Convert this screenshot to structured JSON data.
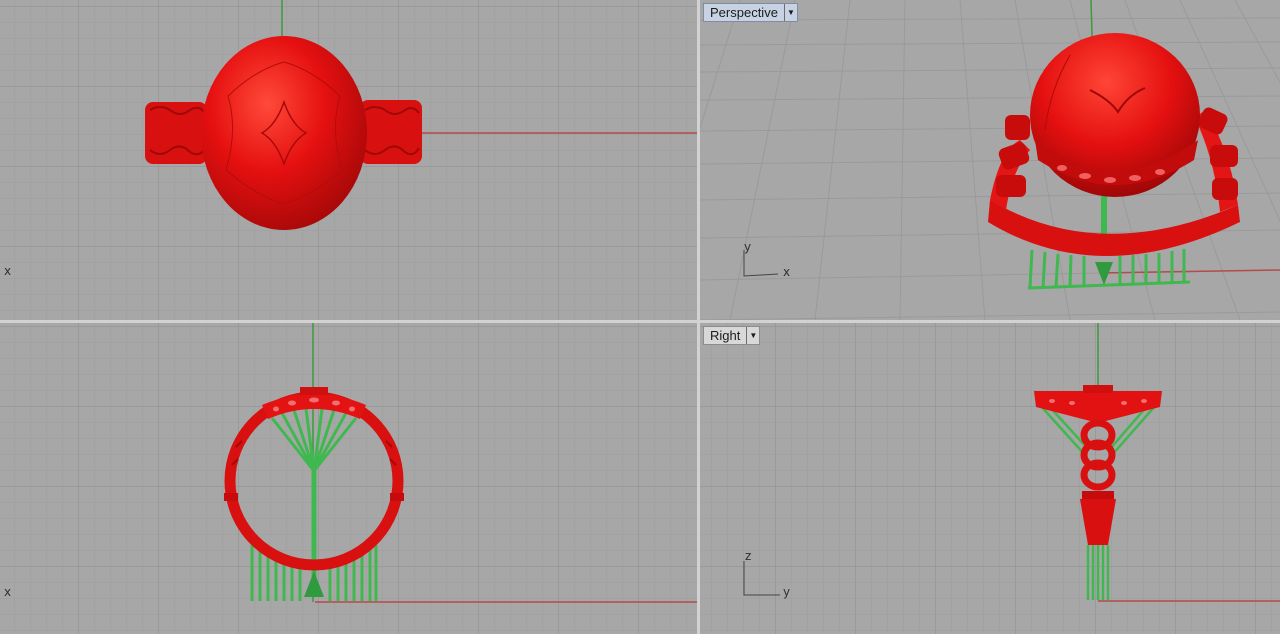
{
  "viewports": {
    "top": {
      "axis_x": "x"
    },
    "perspective": {
      "title": "Perspective",
      "axis_y": "y",
      "axis_x": "x"
    },
    "front": {
      "axis_x": "x"
    },
    "right": {
      "title": "Right",
      "axis_z": "z",
      "axis_y": "y"
    }
  },
  "colors": {
    "background": "#a7a7a7",
    "grid_minor": "#9b9b9b",
    "grid_major": "#8f8f8f",
    "x_axis": "#b44a4a",
    "y_axis": "#3d9a3d",
    "model_red": "#e01010",
    "support_green": "#3fb84f",
    "active_tab": "#c7d3e3"
  },
  "icons": {
    "dropdown": "dropdown-arrow-icon"
  }
}
